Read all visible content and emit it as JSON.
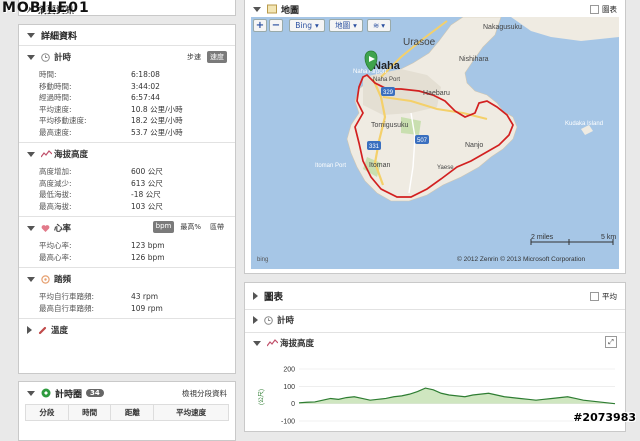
{
  "watermark": {
    "logo_text": "MOBILE01",
    "stamp": "#2073983"
  },
  "left": {
    "summary_title": "摘要資訊",
    "details_title": "詳細資料",
    "timing": {
      "title": "計時",
      "toggle": [
        "步速",
        "速度"
      ],
      "rows": [
        {
          "k": "時間:",
          "v": "6:18:08"
        },
        {
          "k": "移動時間:",
          "v": "3:44:02"
        },
        {
          "k": "經過時間:",
          "v": "6:57:44"
        },
        {
          "k": "平均速度:",
          "v": "10.8 公里/小時"
        },
        {
          "k": "平均移動速度:",
          "v": "18.2 公里/小時"
        },
        {
          "k": "最高速度:",
          "v": "53.7 公里/小時"
        }
      ]
    },
    "elevation": {
      "title": "海拔高度",
      "rows": [
        {
          "k": "高度增加:",
          "v": "600 公尺"
        },
        {
          "k": "高度減少:",
          "v": "613 公尺"
        },
        {
          "k": "最低海拔:",
          "v": "-18 公尺"
        },
        {
          "k": "最高海拔:",
          "v": "103 公尺"
        }
      ]
    },
    "heart": {
      "title": "心率",
      "toggle": [
        "bpm",
        "最高%",
        "區帶"
      ],
      "rows": [
        {
          "k": "平均心率:",
          "v": "123 bpm"
        },
        {
          "k": "最高心率:",
          "v": "126 bpm"
        }
      ]
    },
    "cadence": {
      "title": "踏頻",
      "rows": [
        {
          "k": "平均自行車踏頻:",
          "v": "43 rpm"
        },
        {
          "k": "最高自行車踏頻:",
          "v": "109 rpm"
        }
      ]
    },
    "temperature": {
      "title": "溫度"
    },
    "laps": {
      "title": "計時圈",
      "count": "34",
      "view_link": "檢視分段資料",
      "columns": [
        "分段",
        "時間",
        "距離",
        "平均速度"
      ]
    }
  },
  "map": {
    "title": "地圖",
    "fullscreen_label": "圖表",
    "zoom_in": "+",
    "zoom_out": "−",
    "provider": "Bing",
    "type": "地圖",
    "labels": {
      "urasoe": "Urasoe",
      "nakagusuku": "Nakagusuku",
      "nishihara": "Nishihara",
      "naha": "Naha",
      "naha_airport": "Naha Airport",
      "naha_port": "Naha Port",
      "haebaru": "Haebaru",
      "tomigusuku": "Tomigusuku",
      "nanjo": "Nanjo",
      "itoman_port": "Itoman Port",
      "itoman": "Itoman",
      "yaese": "Yaese",
      "kudaka": "Kudaka Island",
      "r329": "329",
      "r331": "331",
      "r507": "507"
    },
    "scale_miles": "2 miles",
    "scale_km": "5 km",
    "copyright": "© 2012 Zenrin   © 2013 Microsoft Corporation",
    "bing_logo": "bing",
    "colors": {
      "water": "#a6c6e6",
      "land": "#efebe2",
      "route": "#d22020",
      "park": "#c9dfb0"
    }
  },
  "chart": {
    "title": "圖表",
    "avg_label": "平均",
    "timing_row": "計時",
    "elevation_row": "海拔高度",
    "ylabel": "(公尺)"
  },
  "chart_data": {
    "type": "area",
    "ylim": [
      -100,
      200
    ],
    "yticks": [
      "200",
      "100",
      "0",
      "-100"
    ],
    "ylabel": "(公尺)",
    "x": [
      0,
      1,
      2,
      3,
      4,
      5,
      6,
      7,
      8,
      9,
      10,
      11,
      12,
      13,
      14,
      15,
      16,
      17,
      18,
      19,
      20,
      21,
      22,
      23,
      24,
      25,
      26,
      27,
      28,
      29,
      30,
      31,
      32,
      33,
      34,
      35,
      36,
      37,
      38,
      39,
      40
    ],
    "values": [
      5,
      8,
      10,
      20,
      30,
      25,
      35,
      40,
      30,
      20,
      25,
      30,
      40,
      45,
      55,
      70,
      90,
      80,
      60,
      50,
      45,
      40,
      50,
      55,
      60,
      50,
      40,
      35,
      30,
      25,
      20,
      25,
      30,
      35,
      40,
      30,
      20,
      15,
      10,
      5,
      0
    ]
  }
}
